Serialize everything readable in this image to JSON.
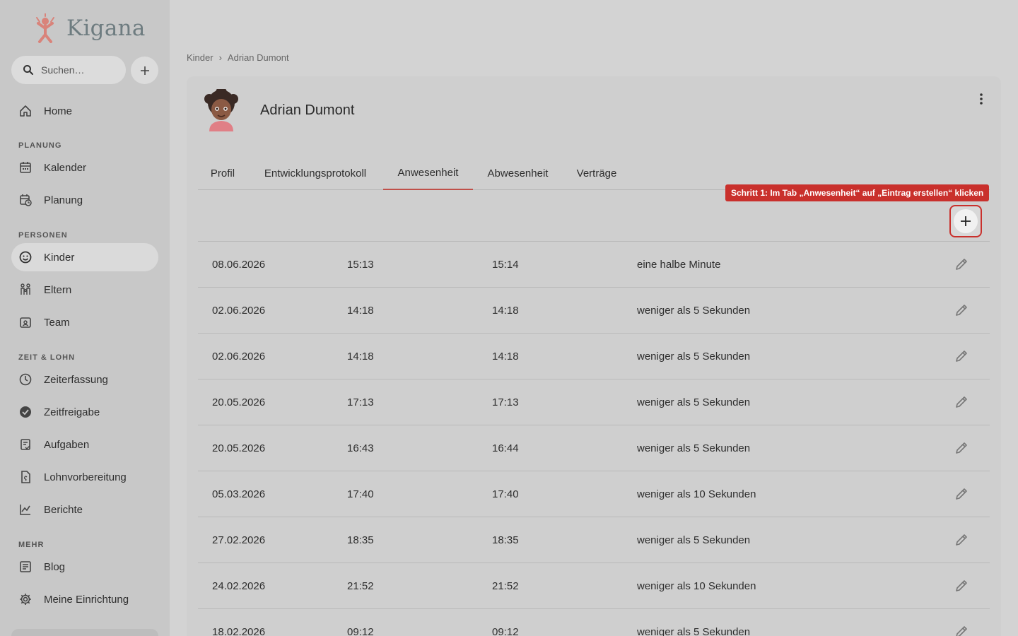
{
  "app": {
    "name": "Kigana"
  },
  "search": {
    "placeholder": "Suchen…"
  },
  "sidebar": {
    "items": [
      {
        "label": "Home",
        "icon": "home-icon"
      },
      {
        "section": "PLANUNG"
      },
      {
        "label": "Kalender",
        "icon": "calendar-icon"
      },
      {
        "label": "Planung",
        "icon": "calendar-clock-icon"
      },
      {
        "section": "PERSONEN"
      },
      {
        "label": "Kinder",
        "icon": "smiley-icon",
        "active": true
      },
      {
        "label": "Eltern",
        "icon": "family-icon"
      },
      {
        "label": "Team",
        "icon": "badge-icon"
      },
      {
        "section": "ZEIT & LOHN"
      },
      {
        "label": "Zeiterfassung",
        "icon": "clock-icon"
      },
      {
        "label": "Zeitfreigabe",
        "icon": "check-circle-icon"
      },
      {
        "label": "Aufgaben",
        "icon": "task-icon"
      },
      {
        "label": "Lohnvorbereitung",
        "icon": "payroll-icon"
      },
      {
        "label": "Berichte",
        "icon": "chart-icon"
      },
      {
        "section": "MEHR"
      },
      {
        "label": "Blog",
        "icon": "blog-icon"
      },
      {
        "label": "Meine Einrichtung",
        "icon": "gear-icon"
      }
    ]
  },
  "breadcrumb": {
    "root": "Kinder",
    "separator": "›",
    "current": "Adrian Dumont"
  },
  "child": {
    "name": "Adrian Dumont"
  },
  "tabs": [
    "Profil",
    "Entwicklungsprotokoll",
    "Anwesenheit",
    "Abwesenheit",
    "Verträge"
  ],
  "active_tab": "Anwesenheit",
  "callout": {
    "text": "Schritt 1: Im Tab „Anwesenheit“ auf „Eintrag erstellen“ klicken"
  },
  "attendance": [
    {
      "date": "08.06.2026",
      "from": "15:13",
      "to": "15:14",
      "duration": "eine halbe Minute"
    },
    {
      "date": "02.06.2026",
      "from": "14:18",
      "to": "14:18",
      "duration": "weniger als 5 Sekunden"
    },
    {
      "date": "02.06.2026",
      "from": "14:18",
      "to": "14:18",
      "duration": "weniger als 5 Sekunden"
    },
    {
      "date": "20.05.2026",
      "from": "17:13",
      "to": "17:13",
      "duration": "weniger als 5 Sekunden"
    },
    {
      "date": "20.05.2026",
      "from": "16:43",
      "to": "16:44",
      "duration": "weniger als 5 Sekunden"
    },
    {
      "date": "05.03.2026",
      "from": "17:40",
      "to": "17:40",
      "duration": "weniger als 10 Sekunden"
    },
    {
      "date": "27.02.2026",
      "from": "18:35",
      "to": "18:35",
      "duration": "weniger als 5 Sekunden"
    },
    {
      "date": "24.02.2026",
      "from": "21:52",
      "to": "21:52",
      "duration": "weniger als 10 Sekunden"
    },
    {
      "date": "18.02.2026",
      "from": "09:12",
      "to": "09:12",
      "duration": "weniger als 5 Sekunden"
    }
  ],
  "colors": {
    "accent": "#c0504a",
    "callout": "#c9302c",
    "logo": "#d9837a"
  }
}
